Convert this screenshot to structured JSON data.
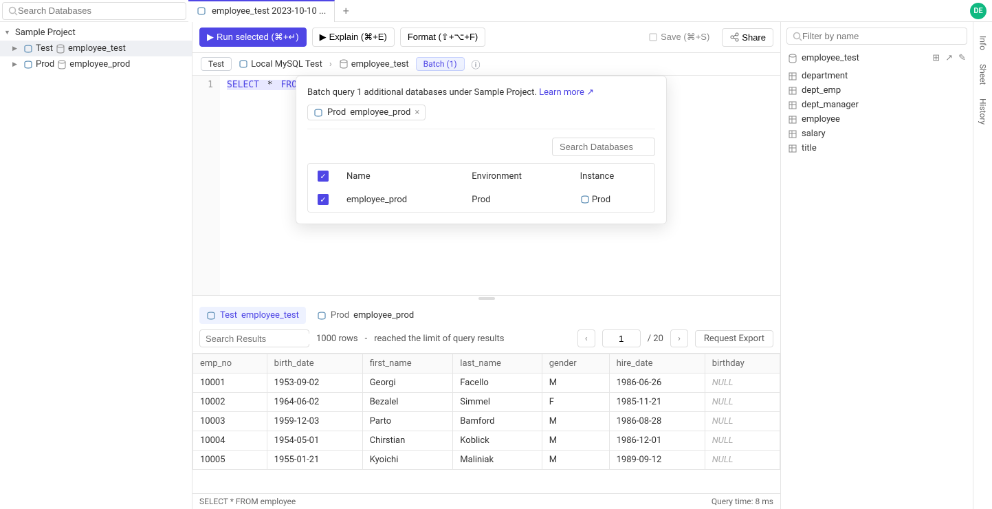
{
  "search_placeholder": "Search Databases",
  "tab": {
    "title": "employee_test 2023-10-10 ..."
  },
  "avatar": "DE",
  "sidebar": {
    "project": "Sample Project",
    "items": [
      {
        "env": "Test",
        "db": "employee_test"
      },
      {
        "env": "Prod",
        "db": "employee_prod"
      }
    ]
  },
  "toolbar": {
    "run": "Run selected (⌘+↵)",
    "explain": "Explain (⌘+E)",
    "format": "Format (⇧+⌥+F)",
    "save": "Save (⌘+S)",
    "share": "Share"
  },
  "context": {
    "env": "Test",
    "instance": "Local MySQL Test",
    "db": "employee_test",
    "batch": "Batch (1)"
  },
  "editor": {
    "line": "1",
    "sql_kw1": "SELECT",
    "sql_star": "*",
    "sql_kw2": "FRO"
  },
  "popup": {
    "text_prefix": "Batch query 1 additional databases under Sample Project.",
    "learn_more": "Learn more",
    "chip_env": "Prod",
    "chip_db": "employee_prod",
    "search_placeholder": "Search Databases",
    "cols": {
      "name": "Name",
      "env": "Environment",
      "instance": "Instance"
    },
    "row": {
      "name": "employee_prod",
      "env": "Prod",
      "instance": "Prod"
    }
  },
  "results": {
    "tabs": [
      {
        "env": "Test",
        "db": "employee_test"
      },
      {
        "env": "Prod",
        "db": "employee_prod"
      }
    ],
    "search_placeholder": "Search Results",
    "row_info": "1000 rows",
    "row_dash": "-",
    "row_limit": "reached the limit of query results",
    "page_current": "1",
    "page_total": "/ 20",
    "request_export": "Request Export",
    "columns": [
      "emp_no",
      "birth_date",
      "first_name",
      "last_name",
      "gender",
      "hire_date",
      "birthday"
    ],
    "rows": [
      [
        "10001",
        "1953-09-02",
        "Georgi",
        "Facello",
        "M",
        "1986-06-26",
        "NULL"
      ],
      [
        "10002",
        "1964-06-02",
        "Bezalel",
        "Simmel",
        "F",
        "1985-11-21",
        "NULL"
      ],
      [
        "10003",
        "1959-12-03",
        "Parto",
        "Bamford",
        "M",
        "1986-08-28",
        "NULL"
      ],
      [
        "10004",
        "1954-05-01",
        "Chirstian",
        "Koblick",
        "M",
        "1986-12-01",
        "NULL"
      ],
      [
        "10005",
        "1955-01-21",
        "Kyoichi",
        "Maliniak",
        "M",
        "1989-09-12",
        "NULL"
      ]
    ]
  },
  "status": {
    "sql": "SELECT * FROM employee",
    "time": "Query time: 8 ms"
  },
  "schema": {
    "filter_placeholder": "Filter by name",
    "db": "employee_test",
    "tables": [
      "department",
      "dept_emp",
      "dept_manager",
      "employee",
      "salary",
      "title"
    ]
  },
  "side_tabs": [
    "Info",
    "Sheet",
    "History"
  ]
}
